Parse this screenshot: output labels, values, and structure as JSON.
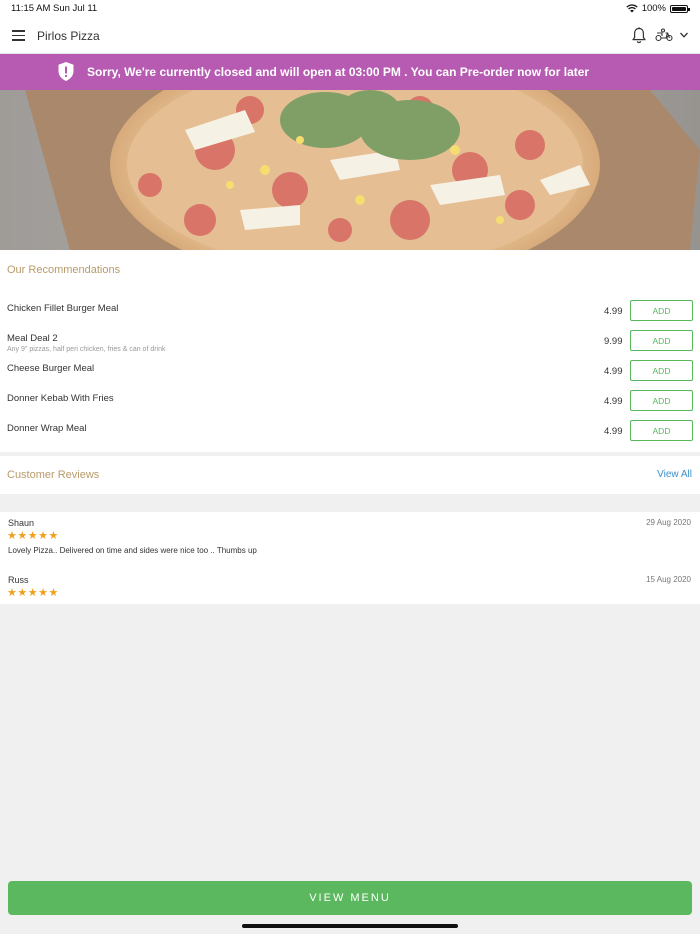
{
  "status_bar": {
    "time": "11:15 AM",
    "date": "Sun Jul 11",
    "battery": "100%"
  },
  "nav": {
    "title": "Pirlos Pizza"
  },
  "banner": {
    "message": "Sorry, We're currently closed and will open at 03:00 PM . You can Pre-order now for later",
    "color": "#b75bb2"
  },
  "recommendations": {
    "title": "Our Recommendations",
    "add_label": "ADD",
    "items": [
      {
        "name": "Chicken Fillet Burger Meal",
        "desc": "",
        "price": "4.99"
      },
      {
        "name": "Meal Deal 2",
        "desc": "Any 9\" pizzas, half peri chicken, fries & can of drink",
        "price": "9.99"
      },
      {
        "name": "Cheese Burger Meal",
        "desc": "",
        "price": "4.99"
      },
      {
        "name": "Donner Kebab With Fries",
        "desc": "",
        "price": "4.99"
      },
      {
        "name": "Donner Wrap Meal",
        "desc": "",
        "price": "4.99"
      }
    ]
  },
  "reviews": {
    "title": "Customer Reviews",
    "view_all": "View All",
    "items": [
      {
        "author": "Shaun",
        "date": "29 Aug 2020",
        "stars": "★★★★★",
        "text": "Lovely Pizza.. Delivered on time and sides were nice too .. Thumbs up"
      },
      {
        "author": "Russ",
        "date": "15 Aug 2020",
        "stars": "★★★★★",
        "text": ""
      }
    ]
  },
  "footer": {
    "view_menu": "VIEW MENU",
    "accent": "#5cb85f"
  }
}
